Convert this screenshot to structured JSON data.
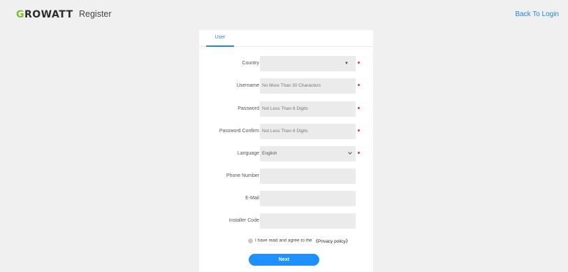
{
  "header": {
    "logo_g": "G",
    "logo_rest": "ROWATT",
    "title": "Register",
    "back_link": "Back To Login"
  },
  "tabs": [
    {
      "label": "User",
      "active": true
    }
  ],
  "form": {
    "country": {
      "label": "Country",
      "value": "",
      "required": true
    },
    "username": {
      "label": "Username",
      "placeholder": "No More Than 30 Characters",
      "required": true
    },
    "password": {
      "label": "Password",
      "placeholder": "Not Less Than 6 Digits",
      "required": true
    },
    "password_confirm": {
      "label": "Password Confirm",
      "placeholder": "Not Less Than 6 Digits",
      "required": true
    },
    "language": {
      "label": "Language",
      "value": "English",
      "required": true
    },
    "phone": {
      "label": "Phone Number",
      "placeholder": ""
    },
    "email": {
      "label": "E-Mail",
      "placeholder": ""
    },
    "installer_code": {
      "label": "Installer Code",
      "placeholder": ""
    }
  },
  "agree": {
    "text": "I have read and agree to the",
    "policy": "《Privacy policy》"
  },
  "next_button": "Next",
  "colors": {
    "accent": "#1e88e5",
    "button": "#1e90ff",
    "required": "#e23a3a",
    "brand_green": "#7fbf2a"
  }
}
